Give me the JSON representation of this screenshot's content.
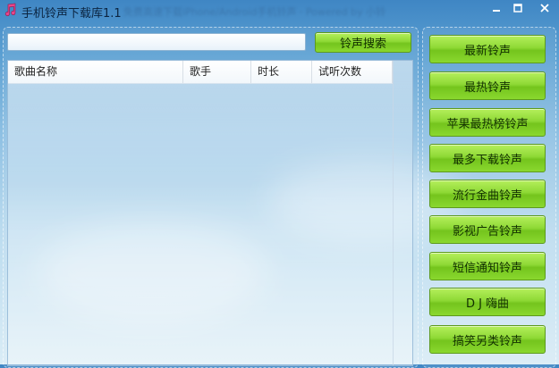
{
  "window": {
    "title": "手机铃声下载库1.1",
    "subtitle": "免费高速下载iPhone/Android手机铃声 · Powered by 小铃",
    "controls": {
      "minimize_icon": "minimize-icon",
      "maximize_icon": "maximize-icon",
      "close_icon": "close-icon"
    }
  },
  "search": {
    "value": "",
    "placeholder": "",
    "button_label": "铃声搜索"
  },
  "song_list": {
    "columns": [
      "歌曲名称",
      "歌手",
      "时长",
      "试听次数"
    ],
    "rows": []
  },
  "sidebar": {
    "buttons": [
      {
        "label": "最新铃声"
      },
      {
        "label": "最热铃声"
      },
      {
        "label": "苹果最热榜铃声"
      },
      {
        "label": "最多下载铃声"
      },
      {
        "label": "流行金曲铃声"
      },
      {
        "label": "影视广告铃声"
      },
      {
        "label": "短信通知铃声"
      },
      {
        "label": "D J 嗨曲"
      },
      {
        "label": "搞笑另类铃声"
      }
    ]
  },
  "colors": {
    "accent_green": "#8ed935",
    "sky_top": "#3f86c4",
    "sky_bottom": "#d9ecf6"
  }
}
